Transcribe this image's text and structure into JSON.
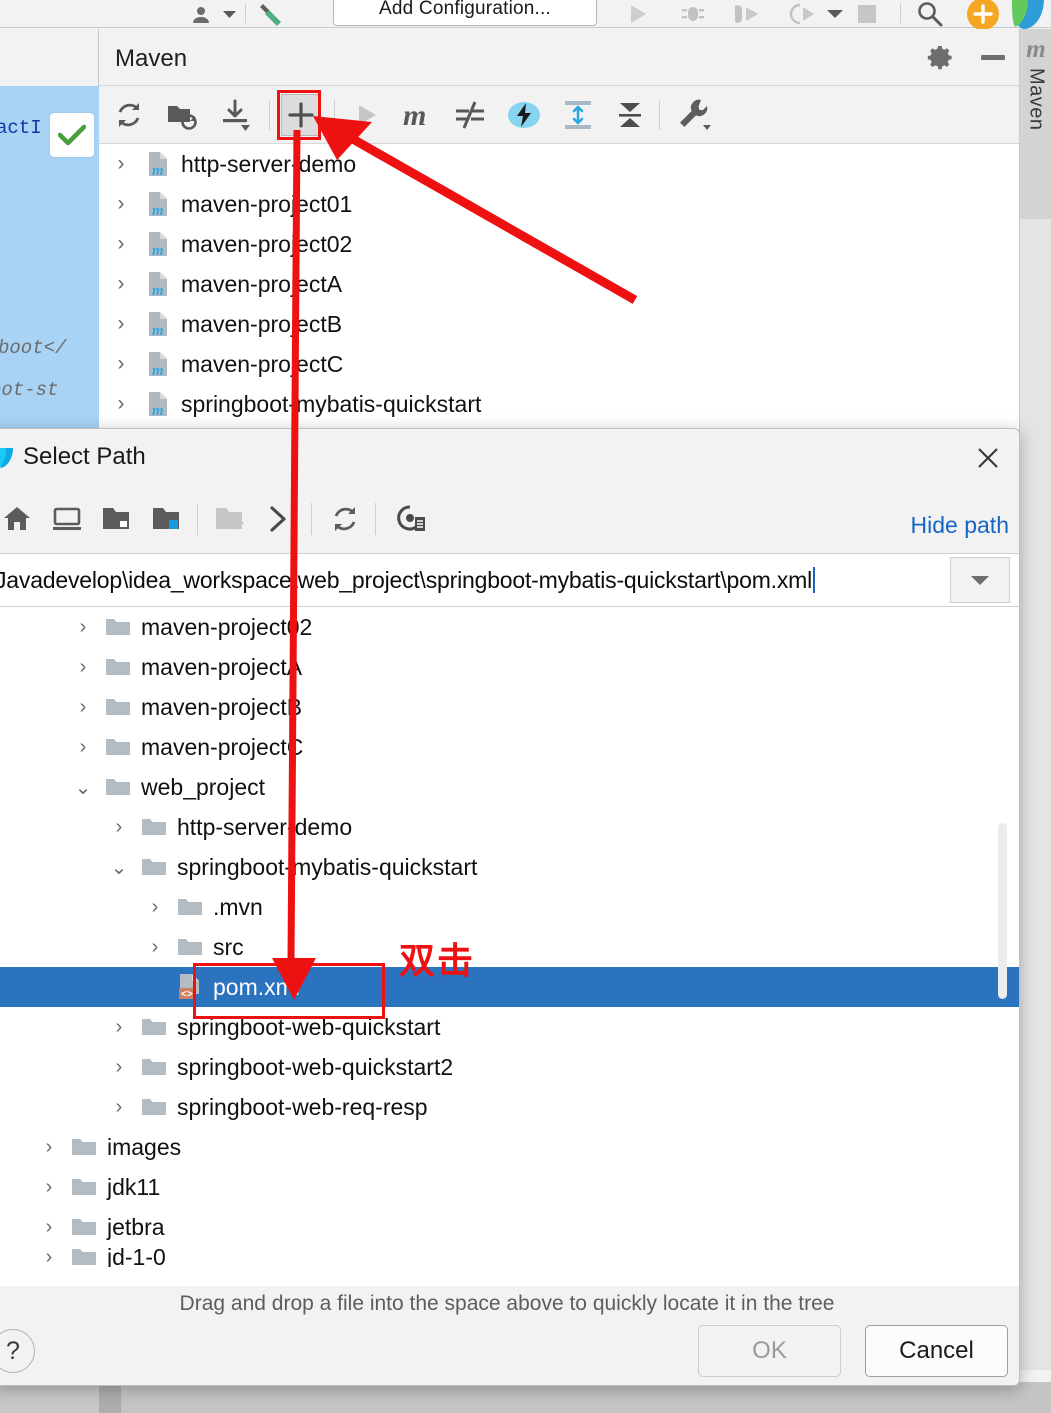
{
  "ide_toolbar": {
    "add_configuration_label": "Add Configuration...",
    "icons": [
      {
        "name": "user-avatar-icon"
      },
      {
        "name": "chevron-down-icon"
      },
      {
        "name": "build-hammer-icon"
      },
      {
        "name": "run-icon"
      },
      {
        "name": "debug-icon"
      },
      {
        "name": "run-with-coverage-icon"
      },
      {
        "name": "profiler-icon"
      },
      {
        "name": "chevron-down-icon"
      },
      {
        "name": "stop-icon"
      },
      {
        "name": "search-everywhere-icon"
      },
      {
        "name": "notification-icon"
      },
      {
        "name": "ide-logo-icon"
      }
    ]
  },
  "editor": {
    "line1": "actI",
    "line2": "boot</",
    "line3": "oot-st",
    "inspection_badge": "check-icon"
  },
  "maven_panel": {
    "title": "Maven",
    "header_buttons": [
      {
        "name": "settings-gear-button",
        "icon": "gear-icon"
      },
      {
        "name": "minimize-button",
        "icon": "minimize-icon"
      }
    ],
    "toolbar": [
      {
        "name": "reload-all-maven-projects-button",
        "icon": "refresh-icon"
      },
      {
        "name": "generate-sources-button",
        "icon": "folder-refresh-icon"
      },
      {
        "name": "download-sources-button",
        "icon": "download-icon"
      },
      {
        "name": "add-maven-project-button",
        "icon": "plus-icon",
        "highlighted": true
      },
      {
        "name": "run-button",
        "icon": "run-icon",
        "disabled": true
      },
      {
        "name": "execute-maven-goal-button",
        "icon": "m-letter-icon"
      },
      {
        "name": "toggle-skip-tests-button",
        "icon": "skip-tests-icon"
      },
      {
        "name": "toggle-offline-mode-button",
        "icon": "lightning-icon"
      },
      {
        "name": "expand-all-button",
        "icon": "expand-all-icon"
      },
      {
        "name": "collapse-all-button",
        "icon": "collapse-all-icon"
      },
      {
        "name": "maven-settings-button",
        "icon": "wrench-icon"
      }
    ],
    "tree": [
      {
        "label": "http-server-demo",
        "icon": "maven-module-icon",
        "expanded": false
      },
      {
        "label": "maven-project01",
        "icon": "maven-module-icon",
        "expanded": false
      },
      {
        "label": "maven-project02",
        "icon": "maven-module-icon",
        "expanded": false
      },
      {
        "label": "maven-projectA",
        "icon": "maven-module-icon",
        "expanded": false
      },
      {
        "label": "maven-projectB",
        "icon": "maven-module-icon",
        "expanded": false
      },
      {
        "label": "maven-projectC",
        "icon": "maven-module-icon",
        "expanded": false
      },
      {
        "label": "springboot-mybatis-quickstart",
        "icon": "maven-module-icon",
        "expanded": false
      }
    ]
  },
  "right_stripe": {
    "tab_label": "Maven",
    "tab_icon": "m-letter-icon"
  },
  "dialog": {
    "title": "Select Path",
    "window_icon": "intellij-logo-icon",
    "close_icon": "close-icon",
    "toolbar": [
      {
        "name": "home-button",
        "icon": "home-icon"
      },
      {
        "name": "desktop-button",
        "icon": "desktop-icon"
      },
      {
        "name": "project-directory-button",
        "icon": "folder-project-icon"
      },
      {
        "name": "module-directory-button",
        "icon": "folder-module-icon"
      },
      {
        "name": "new-folder-button",
        "icon": "folder-add-icon",
        "disabled": true
      },
      {
        "name": "expand-path-button",
        "icon": "chevron-right-icon"
      },
      {
        "name": "refresh-button",
        "icon": "refresh-icon"
      },
      {
        "name": "show-hidden-files-button",
        "icon": "hidden-files-icon"
      }
    ],
    "hide_path_label": "Hide path",
    "path_value": "Javadevelop\\idea_workspace\\web_project\\springboot-mybatis-quickstart\\pom.xml",
    "path_dropdown_icon": "chevron-down-icon",
    "tree": [
      {
        "label": "maven-project02",
        "icon": "folder-icon",
        "indent": 0,
        "state": "collapsed",
        "selected": false
      },
      {
        "label": "maven-projectA",
        "icon": "folder-icon",
        "indent": 0,
        "state": "collapsed",
        "selected": false
      },
      {
        "label": "maven-projectB",
        "icon": "folder-icon",
        "indent": 0,
        "state": "collapsed",
        "selected": false
      },
      {
        "label": "maven-projectC",
        "icon": "folder-icon",
        "indent": 0,
        "state": "collapsed",
        "selected": false
      },
      {
        "label": "web_project",
        "icon": "folder-icon",
        "indent": 0,
        "state": "expanded",
        "selected": false
      },
      {
        "label": "http-server-demo",
        "icon": "folder-icon",
        "indent": 1,
        "state": "collapsed",
        "selected": false
      },
      {
        "label": "springboot-mybatis-quickstart",
        "icon": "folder-icon",
        "indent": 1,
        "state": "expanded",
        "selected": false
      },
      {
        "label": ".mvn",
        "icon": "folder-icon",
        "indent": 2,
        "state": "collapsed",
        "selected": false
      },
      {
        "label": "src",
        "icon": "folder-icon",
        "indent": 2,
        "state": "collapsed",
        "selected": false
      },
      {
        "label": "pom.xml",
        "icon": "xml-file-icon",
        "indent": 2,
        "state": "leaf",
        "selected": true
      },
      {
        "label": "springboot-web-quickstart",
        "icon": "folder-icon",
        "indent": 1,
        "state": "collapsed",
        "selected": false
      },
      {
        "label": "springboot-web-quickstart2",
        "icon": "folder-icon",
        "indent": 1,
        "state": "collapsed",
        "selected": false
      },
      {
        "label": "springboot-web-req-resp",
        "icon": "folder-icon",
        "indent": 1,
        "state": "collapsed",
        "selected": false
      },
      {
        "label": "images",
        "icon": "folder-icon",
        "indent": 0,
        "state": "collapsed",
        "selected": false
      },
      {
        "label": "jdk11",
        "icon": "folder-icon",
        "indent": 0,
        "state": "collapsed",
        "selected": false
      },
      {
        "label": "jetbra",
        "icon": "folder-icon",
        "indent": 0,
        "state": "collapsed",
        "selected": false
      },
      {
        "label": "jd-1-0",
        "icon": "folder-icon",
        "indent": 0,
        "state": "collapsed",
        "selected": false
      }
    ],
    "hint": "Drag and drop a file into the space above to quickly locate it in the tree",
    "help_label": "?",
    "ok_label": "OK",
    "ok_disabled": true,
    "cancel_label": "Cancel"
  },
  "annotations": {
    "double_click_label": "双击",
    "accent_color": "#ee1111",
    "selection_color": "#2b72bf",
    "link_color": "#1567c4"
  }
}
